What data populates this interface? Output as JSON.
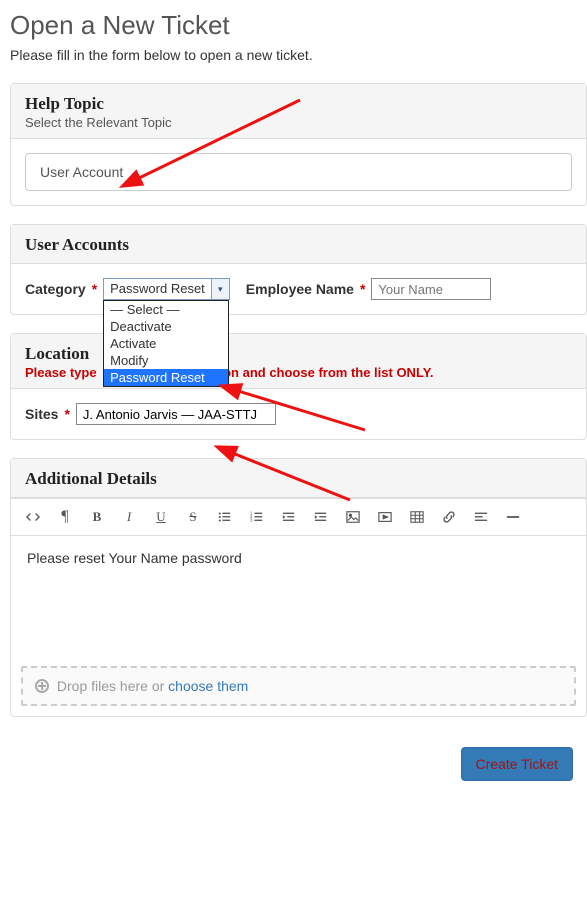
{
  "page": {
    "title": "Open a New Ticket",
    "instructions": "Please fill in the form below to open a new ticket."
  },
  "help_topic": {
    "heading": "Help Topic",
    "sub": "Select the Relevant Topic",
    "value": "User Account"
  },
  "user_accounts": {
    "heading": "User Accounts",
    "category_label": "Category",
    "category_value": "Password Reset",
    "category_options": [
      "— Select —",
      "Deactivate",
      "Activate",
      "Modify",
      "Password Reset"
    ],
    "category_selected_index": 4,
    "employee_label": "Employee Name",
    "employee_placeholder": "Your Name"
  },
  "location": {
    "heading": "Location",
    "warn_prefix": "Please type",
    "warn_suffix": "ion and choose from the list ONLY.",
    "sites_label": "Sites",
    "sites_value": "J. Antonio Jarvis — JAA-STTJ"
  },
  "details": {
    "heading": "Additional Details",
    "body": "Please reset Your Name password",
    "drop_text": "Drop files here or ",
    "choose_text": "choose them"
  },
  "buttons": {
    "create": "Create Ticket"
  },
  "toolbar_icons": [
    "code",
    "pilcrow",
    "bold",
    "italic",
    "underline",
    "strike",
    "ul",
    "ol",
    "outdent",
    "indent",
    "image",
    "video",
    "table",
    "link",
    "align",
    "hr"
  ]
}
